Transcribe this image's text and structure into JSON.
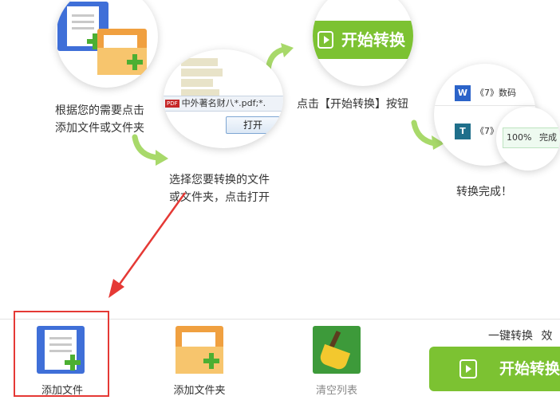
{
  "steps": {
    "step1": {
      "caption_line1": "根据您的需要点击",
      "caption_line2": "添加文件或文件夹"
    },
    "step2": {
      "caption_line1": "选择您要转换的文件",
      "caption_line2": "或文件夹，点击打开",
      "file_name": "中外著名财八*.pdf;*.",
      "open_button": "打开",
      "pdf_tag": "PDF"
    },
    "step3": {
      "caption": "点击【开始转换】按钮",
      "button_label": "开始转换"
    },
    "step4": {
      "caption": "转换完成！",
      "row1_name": "《7》数码",
      "row2_name": "《7》",
      "progress_text": "100%",
      "status_text": "完成",
      "word_tag": "W",
      "t_tag": "T"
    }
  },
  "toolbar": {
    "add_file": "添加文件",
    "add_folder": "添加文件夹",
    "clear_list": "清空列表",
    "one_click": "一键转换",
    "effect_partial": "效",
    "start_button": "开始转换"
  },
  "colors": {
    "accent_green": "#7cc232",
    "highlight_red": "#e53935"
  }
}
